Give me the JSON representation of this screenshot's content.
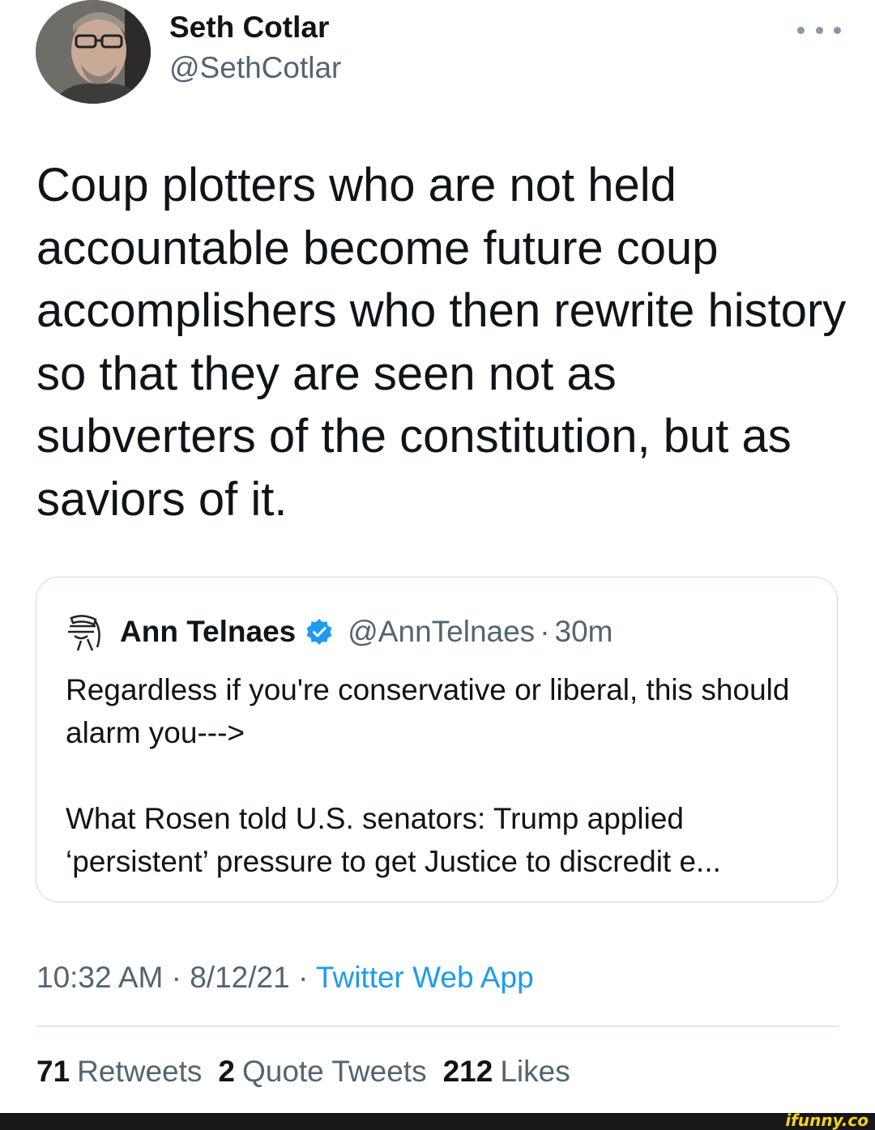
{
  "author": {
    "name": "Seth Cotlar",
    "handle": "@SethCotlar"
  },
  "tweet": {
    "text": "Coup plotters who are not held accountable become future coup accomplishers who then rewrite history so that they are seen not as subverters of the constitution, but as saviors of it."
  },
  "quoted_tweet": {
    "name": "Ann Telnaes",
    "handle": "@AnnTelnaes",
    "separator": "·",
    "time": "30m",
    "paragraph_1": "Regardless if you're conservative or liberal, this should alarm you--->",
    "paragraph_2": "What Rosen told U.S. senators: Trump applied ‘persistent’ pressure to get Justice to discredit e..."
  },
  "meta": {
    "time": "10:32 AM",
    "separator": "·",
    "date": "8/12/21",
    "source": "Twitter Web App"
  },
  "stats": {
    "retweets_count": "71",
    "retweets_label": "Retweets",
    "quotes_count": "2",
    "quotes_label": "Quote Tweets",
    "likes_count": "212",
    "likes_label": "Likes"
  },
  "watermark": "ifunny.co",
  "colors": {
    "text_primary": "#0f1419",
    "text_secondary": "#536471",
    "link": "#1d9bf0",
    "verified": "#1d9bf0",
    "border": "#cfd9de",
    "watermark": "#f2d21b",
    "footer_bar": "#17171a"
  },
  "icons": {
    "more": "more-horizontal-icon",
    "verified": "verified-badge-icon"
  }
}
